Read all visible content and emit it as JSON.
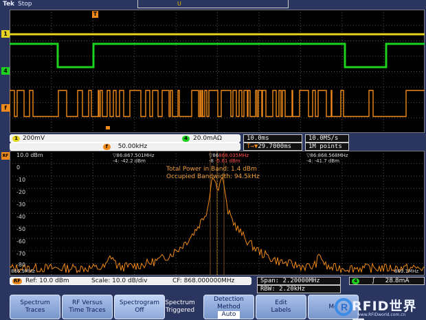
{
  "header": {
    "brand": "Tek",
    "state": "Stop",
    "trigger_pos_marker": "U"
  },
  "channels": [
    {
      "id": "1",
      "color": "#e7d420"
    },
    {
      "id": "4",
      "color": "#1fd11f"
    },
    {
      "id": "f",
      "color": "#f08a1a"
    }
  ],
  "trigger_marker": "T",
  "status": {
    "ch1_scale": "200mV",
    "ch4_scale": "20.0mAΩ",
    "math_scale": "50.00kHz",
    "timebase": "10.0ms",
    "trigger_delay": "29.7000ms",
    "sample_rate": "10.0MS/s",
    "record_length": "1M points"
  },
  "spectrum": {
    "top_label": "10.0 dBm",
    "y_labels": [
      "0",
      "-10",
      "-20",
      "-30",
      "-40",
      "-50",
      "-60",
      "-70",
      "-80"
    ],
    "start_freq": "866.9MHz",
    "stop_freq": "869.1MHz",
    "total_power": "Total Power in Band: 1.4 dBm",
    "occupied_bw": "Occupied Bandwidth: 94.5kHz",
    "markers": [
      {
        "label": "▽86:",
        "freq": "867.501MHz",
        "delta": "-4:",
        "level": "-42.2 dBm"
      },
      {
        "label": "▽86",
        "freq": "868.035MHz",
        "delta": "-8",
        "level": "-5.61 dBm"
      },
      {
        "label": "▽86:",
        "freq": "868.568MHz",
        "delta": "-4:",
        "level": "-41.7 dBm"
      }
    ]
  },
  "spec_status": {
    "rf_badge": "RF",
    "ref": "Ref: 10.0 dBm",
    "scale": "Scale: 10.0 dB/div",
    "cf": "CF: 868.000000MHz",
    "span": "Span:  2.20000MHz",
    "rbw": "RBW:  2.20kHz",
    "trig_badge": "4",
    "trig_level": "28.8mA"
  },
  "softkeys": [
    {
      "line1": "Spectrum",
      "line2": "Traces"
    },
    {
      "line1": "RF Versus",
      "line2": "Time Traces"
    },
    {
      "line1": "Spectrogram",
      "line2": "Off"
    },
    {
      "line1": "Spectrum",
      "line2": "Triggered"
    },
    {
      "line1": "Detection",
      "line2": "Method",
      "line3": "Auto"
    },
    {
      "line1": "Edit",
      "line2": "Labels"
    },
    {
      "line1": "Mo"
    }
  ],
  "watermark": {
    "text": "RFID世界网",
    "sub": "www.RFIDworld.com.cn"
  }
}
